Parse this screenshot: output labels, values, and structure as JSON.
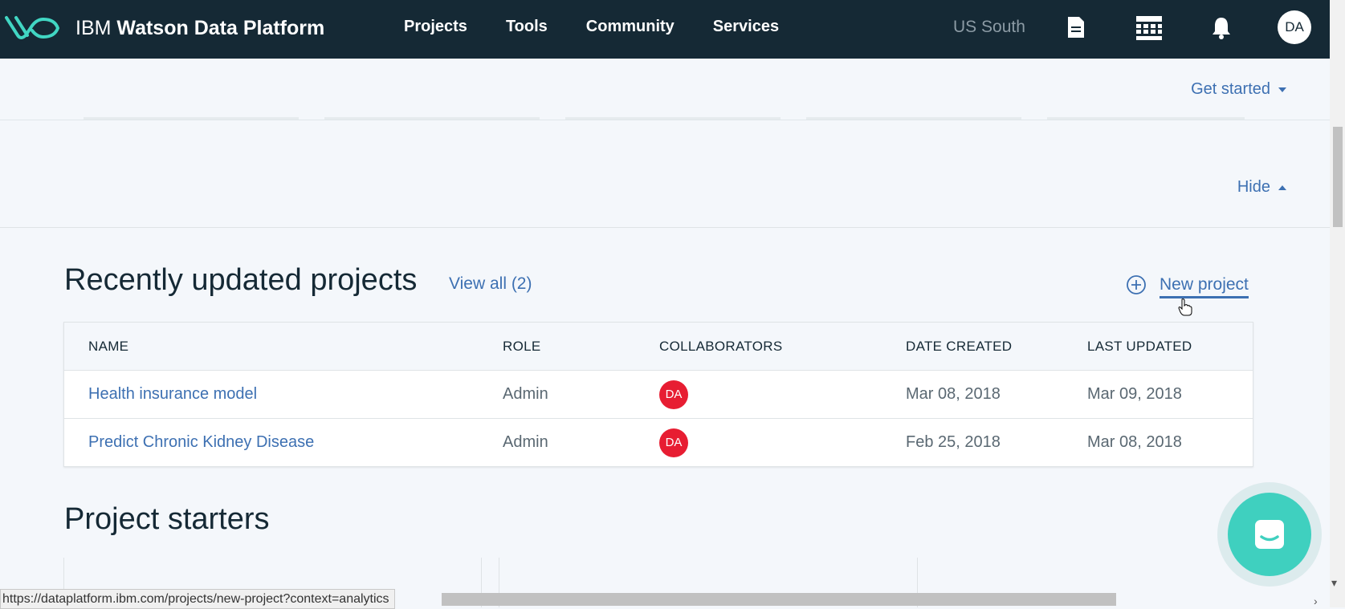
{
  "header": {
    "brand_light": "IBM",
    "brand_bold": "Watson Data Platform",
    "nav": [
      "Projects",
      "Tools",
      "Community",
      "Services"
    ],
    "region": "US South",
    "avatar_initials": "DA",
    "icons": [
      "document-icon",
      "catalog-grid-icon",
      "bell-icon"
    ]
  },
  "get_started": {
    "label": "Get started"
  },
  "hide": {
    "label": "Hide"
  },
  "recent": {
    "title": "Recently updated projects",
    "view_all": "View all (2)",
    "new_project": "New project",
    "columns": [
      "NAME",
      "ROLE",
      "COLLABORATORS",
      "DATE CREATED",
      "LAST UPDATED"
    ],
    "rows": [
      {
        "name": "Health insurance model",
        "role": "Admin",
        "collaborator": "DA",
        "created": "Mar 08, 2018",
        "updated": "Mar 09, 2018"
      },
      {
        "name": "Predict Chronic Kidney Disease",
        "role": "Admin",
        "collaborator": "DA",
        "created": "Feb 25, 2018",
        "updated": "Mar 08, 2018"
      }
    ]
  },
  "starters": {
    "title": "Project starters"
  },
  "status_bar": {
    "url": "https://dataplatform.ibm.com/projects/new-project?context=analytics"
  },
  "colors": {
    "header_bg": "#152935",
    "link": "#3d70b2",
    "avatar_red": "#e71d32",
    "chat_teal": "#3fd0bf"
  }
}
